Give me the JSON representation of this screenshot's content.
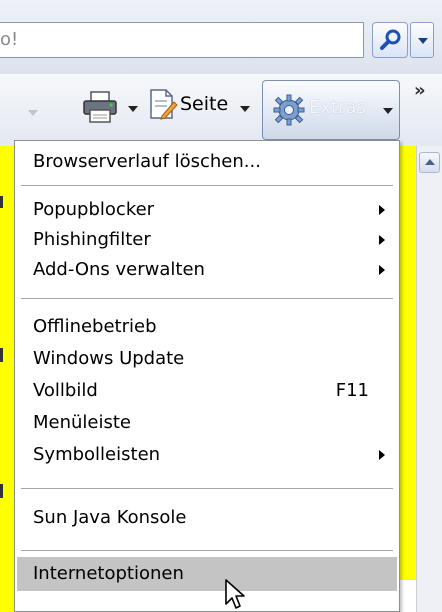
{
  "search": {
    "value": "o!"
  },
  "command_bar": {
    "page_label": "Seite",
    "extras_label": "Extras",
    "more_symbol": "»"
  },
  "menu": {
    "items": [
      {
        "label": "Browserverlauf löschen..."
      },
      {
        "label": "Popupblocker",
        "submenu": true
      },
      {
        "label": "Phishingfilter",
        "submenu": true
      },
      {
        "label": "Add-Ons verwalten",
        "submenu": true
      },
      {
        "label": "Offlinebetrieb"
      },
      {
        "label": "Windows Update"
      },
      {
        "label": "Vollbild",
        "shortcut": "F11"
      },
      {
        "label": "Menüleiste"
      },
      {
        "label": "Symbolleisten",
        "submenu": true
      },
      {
        "label": "Sun Java Konsole"
      },
      {
        "label": "Internetoptionen",
        "highlighted": true
      }
    ]
  },
  "colors": {
    "page_background": "#ffff00",
    "menu_highlight": "#c4c4c4",
    "accent_blue": "#1c3d86"
  }
}
